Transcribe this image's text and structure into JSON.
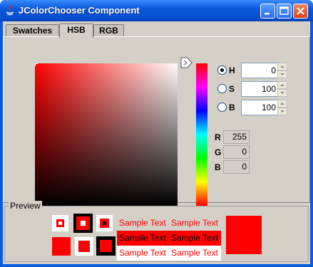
{
  "window": {
    "title": "JColorChooser Component"
  },
  "tabs": [
    {
      "label": "Swatches",
      "active": false
    },
    {
      "label": "HSB",
      "active": true
    },
    {
      "label": "RGB",
      "active": false
    }
  ],
  "hsb": {
    "h": {
      "label": "H",
      "value": "0",
      "selected": true
    },
    "s": {
      "label": "S",
      "value": "100",
      "selected": false
    },
    "b": {
      "label": "B",
      "value": "100",
      "selected": false
    }
  },
  "rgb_readout": {
    "r": {
      "label": "R",
      "value": "255"
    },
    "g": {
      "label": "G",
      "value": "0"
    },
    "b": {
      "label": "B",
      "value": "0"
    }
  },
  "preview": {
    "title": "Preview",
    "sample_text": "Sample Text",
    "color": "#ff0000"
  },
  "colors": {
    "titlebar": "#0a5cde",
    "panel": "#d4d0c8",
    "selected": "#ff0000"
  }
}
